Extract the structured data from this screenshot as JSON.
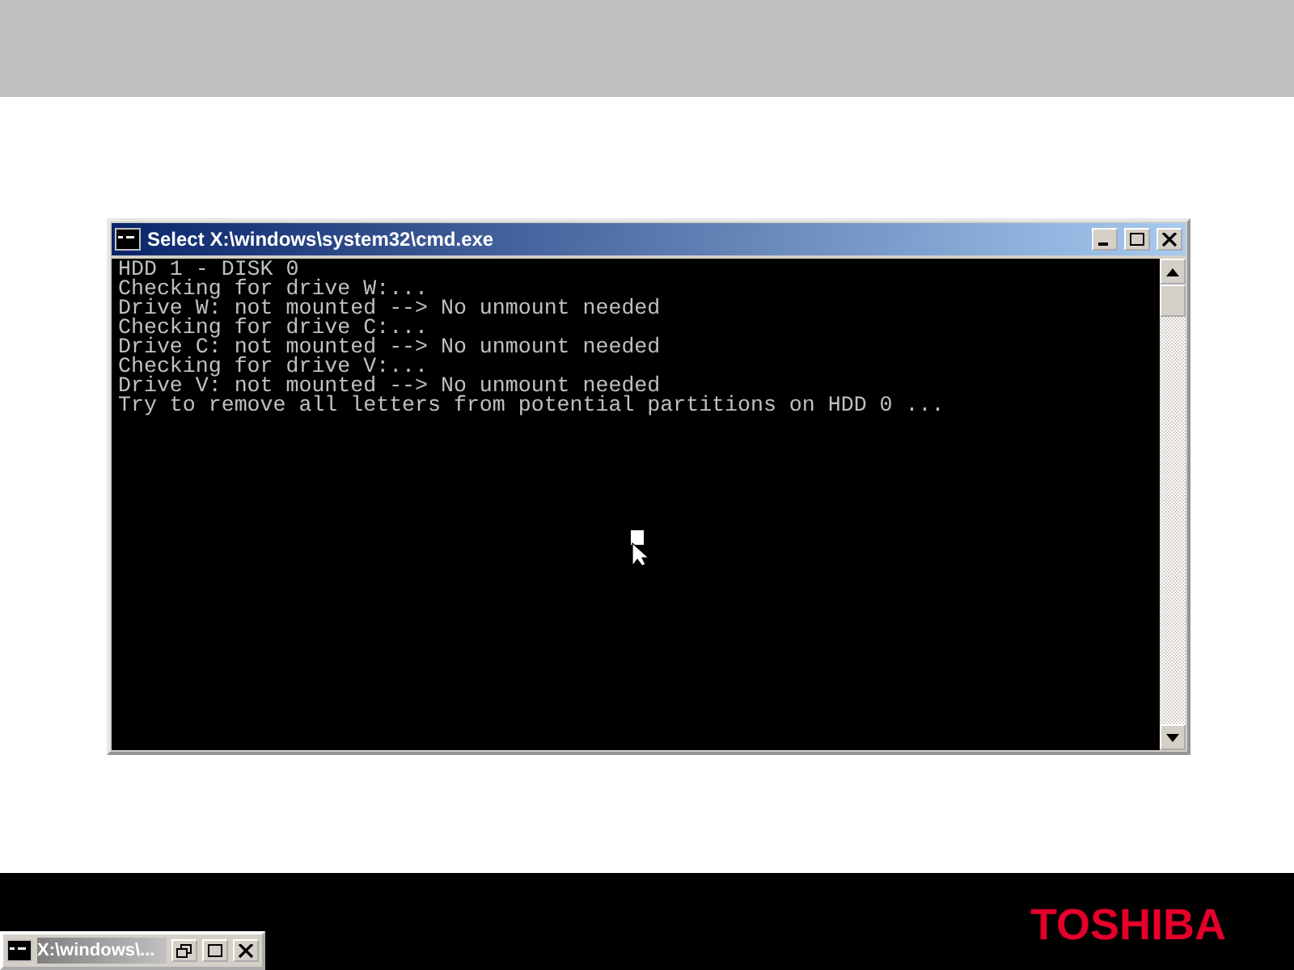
{
  "window": {
    "title": "Select X:\\windows\\system32\\cmd.exe"
  },
  "console_lines": [
    "HDD 1 - DISK 0",
    "Checking for drive W:...",
    "Drive W: not mounted --> No unmount needed",
    "Checking for drive C:...",
    "Drive C: not mounted --> No unmount needed",
    "Checking for drive V:...",
    "Drive V: not mounted --> No unmount needed",
    "Try to remove all letters from potential partitions on HDD 0 ..."
  ],
  "minimized_window": {
    "title": "X:\\windows\\..."
  },
  "logo": "TOSHIBA"
}
